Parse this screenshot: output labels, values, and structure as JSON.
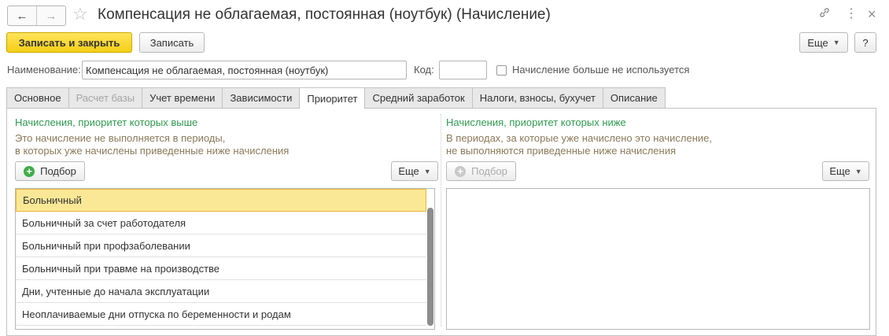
{
  "window": {
    "title": "Компенсация не облагаемая, постоянная (ноутбук) (Начисление)",
    "nav_back": "←",
    "nav_forward": "→",
    "favorite": "☆",
    "icon_link": "🔗",
    "icon_menu": "⋮",
    "icon_close": "×"
  },
  "toolbar": {
    "save_close": "Записать и закрыть",
    "save": "Записать",
    "more": "Еще",
    "help": "?"
  },
  "form": {
    "name_label": "Наименование:",
    "name_value": "Компенсация не облагаемая, постоянная (ноутбук)",
    "code_label": "Код:",
    "code_value": "",
    "unused_label": "Начисление больше не используется"
  },
  "tabs": [
    {
      "label": "Основное"
    },
    {
      "label": "Расчет базы"
    },
    {
      "label": "Учет времени"
    },
    {
      "label": "Зависимости"
    },
    {
      "label": "Приоритет"
    },
    {
      "label": "Средний заработок"
    },
    {
      "label": "Налоги, взносы, бухучет"
    },
    {
      "label": "Описание"
    }
  ],
  "left": {
    "header": "Начисления, приоритет которых выше",
    "hint1": "Это начисление не выполняется в периоды,",
    "hint2": "в которых уже начислены приведенные ниже начисления",
    "pick": "Подбор",
    "more": "Еще",
    "items": [
      "Больничный",
      "Больничный за счет работодателя",
      "Больничный при профзаболевании",
      "Больничный при травме на производстве",
      "Дни, учтенные до начала эксплуатации",
      "Неоплачиваемые дни отпуска по беременности и родам"
    ]
  },
  "right": {
    "header": "Начисления, приоритет которых ниже",
    "hint1": "В периодах, за которые уже начислено это начисление,",
    "hint2": "не выполняются приведенные ниже начисления",
    "pick": "Подбор",
    "more": "Еще"
  },
  "colors": {
    "accent": "#f5cf15",
    "green": "#2f9a4f",
    "selection": "#fbe896"
  }
}
